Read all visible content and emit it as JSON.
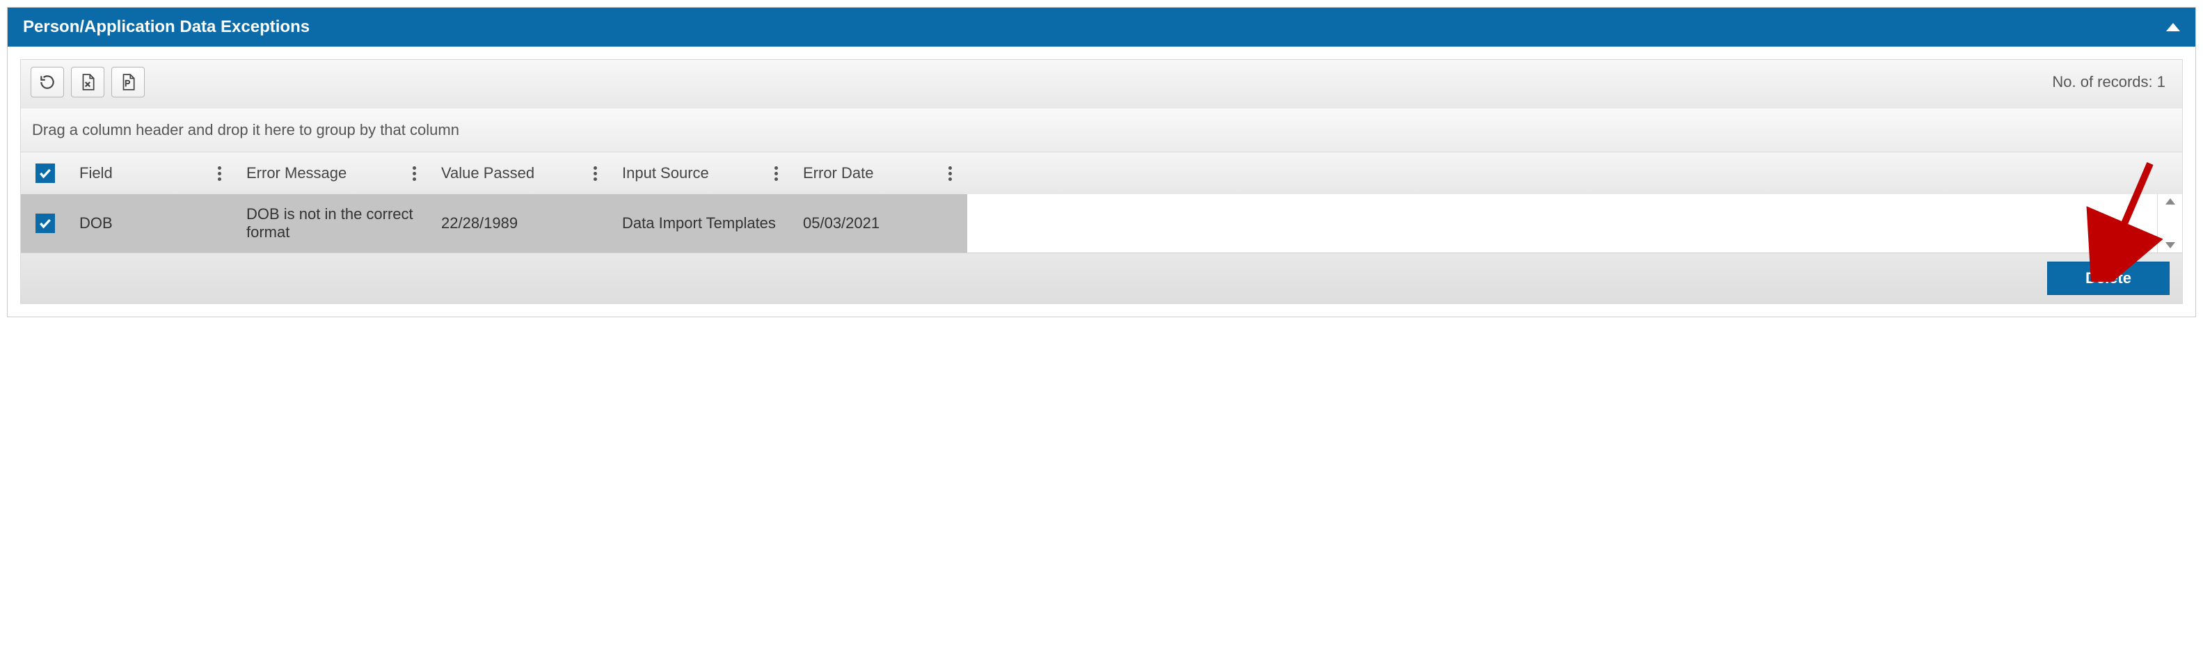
{
  "panel": {
    "title": "Person/Application Data Exceptions"
  },
  "toolbar": {
    "records_label": "No. of records: 1"
  },
  "group_panel": {
    "hint": "Drag a column header and drop it here to group by that column"
  },
  "columns": {
    "field": "Field",
    "error_message": "Error Message",
    "value_passed": "Value Passed",
    "input_source": "Input Source",
    "error_date": "Error Date"
  },
  "rows": [
    {
      "checked": true,
      "field": "DOB",
      "error_message": "DOB is not in the correct format",
      "value_passed": "22/28/1989",
      "input_source": "Data Import Templates",
      "error_date": "05/03/2021"
    }
  ],
  "footer": {
    "delete_label": "Delete"
  }
}
